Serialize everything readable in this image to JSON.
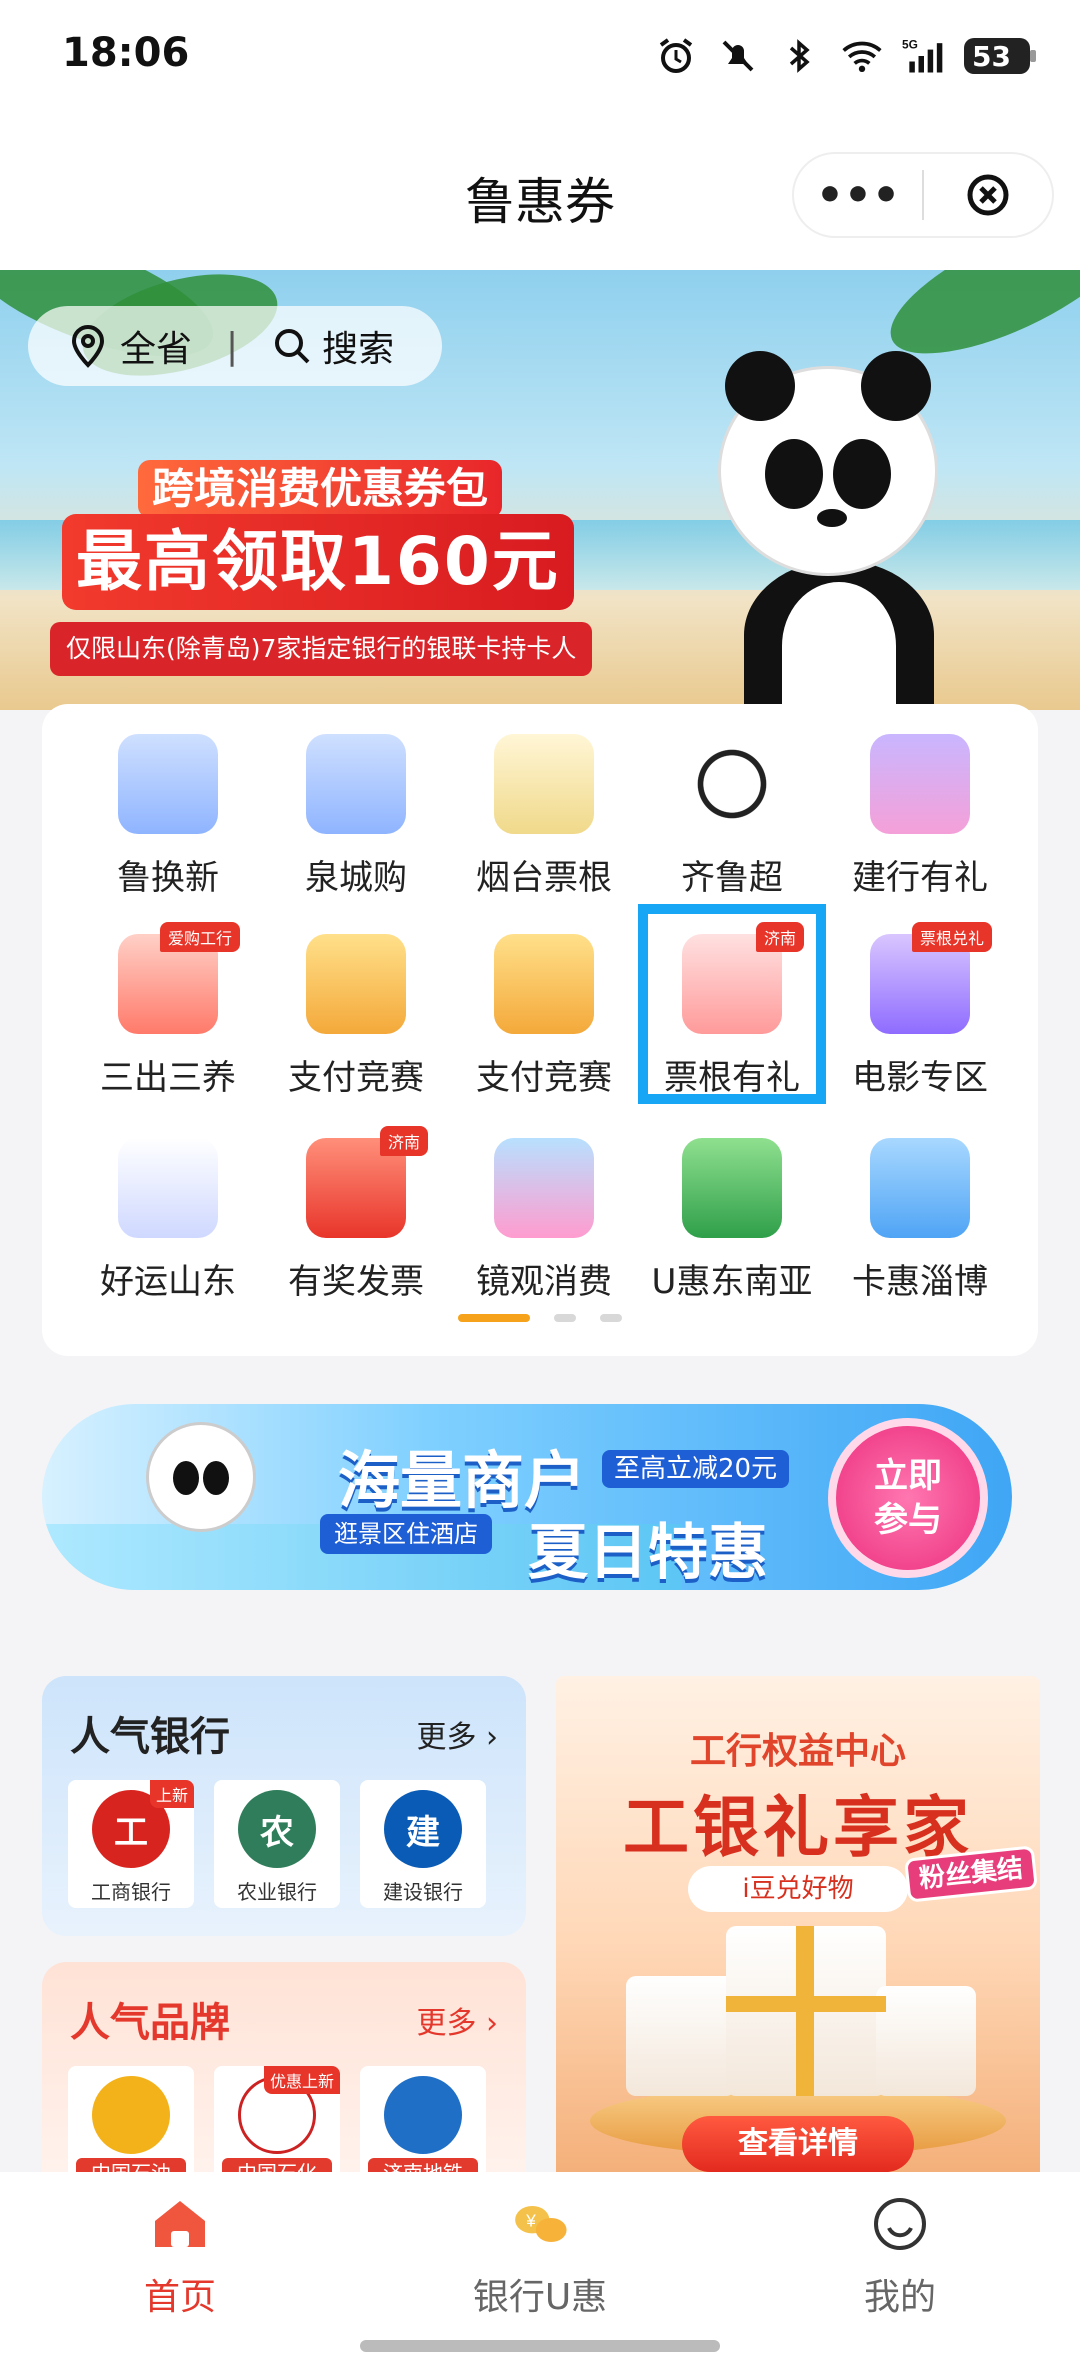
{
  "status_bar": {
    "time": "18:06",
    "battery": "53",
    "icons": [
      "alarm-icon",
      "mute-icon",
      "bluetooth-icon",
      "wifi-icon",
      "signal-5g-icon",
      "battery-icon"
    ]
  },
  "header": {
    "title": "鲁惠券",
    "more_label": "•••",
    "close_label": "⊗"
  },
  "banner": {
    "region_label": "全省",
    "search_label": "搜索",
    "subtitle": "跨境消费优惠券包",
    "headline": "最高领取160元",
    "note": "仅限山东(除青岛)7家指定银行的银联卡持卡人"
  },
  "grid": {
    "rows": [
      [
        {
          "label": "鲁换新",
          "icon": "cart-icon",
          "badge": ""
        },
        {
          "label": "泉城购",
          "icon": "cart-icon",
          "badge": ""
        },
        {
          "label": "烟台票根",
          "icon": "receipt-icon",
          "badge": ""
        },
        {
          "label": "齐鲁超",
          "icon": "soccer-ball-icon",
          "badge": ""
        },
        {
          "label": "建行有礼",
          "icon": "gift-box-icon",
          "badge": ""
        }
      ],
      [
        {
          "label": "三出三养",
          "icon": "bank-building-icon",
          "badge": "爱购工行"
        },
        {
          "label": "支付竞赛",
          "icon": "wallet-icon",
          "badge": ""
        },
        {
          "label": "支付竞赛",
          "icon": "wallet-icon",
          "badge": ""
        },
        {
          "label": "票根有礼",
          "icon": "ticket-stub-icon",
          "badge": "济南"
        },
        {
          "label": "电影专区",
          "icon": "film-icon",
          "badge": "票根兑礼"
        }
      ],
      [
        {
          "label": "好运山东",
          "icon": "shuttlecock-icon",
          "badge": ""
        },
        {
          "label": "有奖发票",
          "icon": "invoice-envelope-icon",
          "badge": "济南"
        },
        {
          "label": "镜观消费",
          "icon": "picture-frame-icon",
          "badge": ""
        },
        {
          "label": "U惠东南亚",
          "icon": "palm-tree-icon",
          "badge": ""
        },
        {
          "label": "卡惠淄博",
          "icon": "credit-card-icon",
          "badge": ""
        }
      ]
    ],
    "page_count": 3,
    "active_page": 1
  },
  "promo": {
    "title": "海量商户",
    "tag": "至高立减20元",
    "subtitle": "逛景区住酒店",
    "title2": "夏日特惠",
    "cta": "立即参与"
  },
  "banks": {
    "title": "人气银行",
    "more": "更多 ›",
    "items": [
      {
        "name": "工商银行",
        "tag": "上新",
        "color": "#d8241f",
        "glyph": "工"
      },
      {
        "name": "农业银行",
        "tag": "",
        "color": "#2f7d5b",
        "glyph": "农"
      },
      {
        "name": "建设银行",
        "tag": "",
        "color": "#0a5bb5",
        "glyph": "建"
      }
    ]
  },
  "brands": {
    "title": "人气品牌",
    "more": "更多 ›",
    "items": [
      {
        "name": "中国石油",
        "tag": ""
      },
      {
        "name": "中国石化",
        "tag": "优惠上新"
      },
      {
        "name": "济南地铁",
        "tag": ""
      }
    ]
  },
  "gift_promo": {
    "line1": "工行权益中心",
    "line2": "工银礼享家",
    "line3": "i豆兑好物",
    "fan_tag": "粉丝集结",
    "cta": "查看详情"
  },
  "tabbar": {
    "tabs": [
      {
        "label": "首页",
        "icon": "home-icon",
        "active": true
      },
      {
        "label": "银行U惠",
        "icon": "coins-icon",
        "active": false
      },
      {
        "label": "我的",
        "icon": "smiley-face-icon",
        "active": false
      }
    ]
  },
  "colors": {
    "accent_red": "#e4382c",
    "highlight_blue": "#17a6f5",
    "pager_active": "#f6a21a"
  }
}
